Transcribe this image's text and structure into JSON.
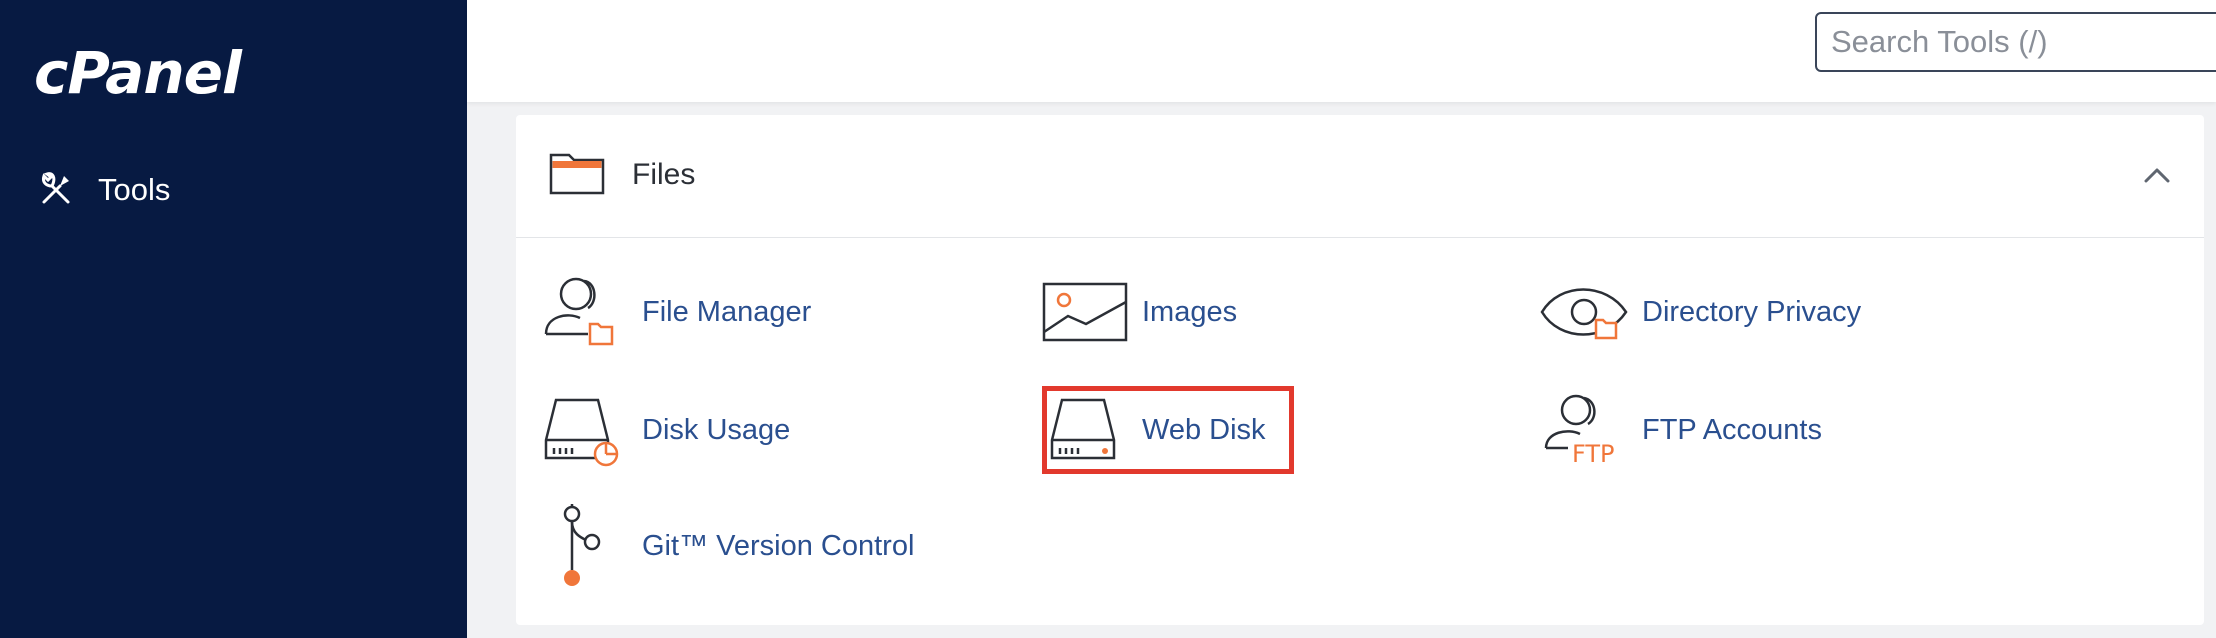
{
  "app": {
    "logo": "cPanel",
    "brand_color": "#071a42",
    "accent_color": "#f0763a",
    "link_color": "#2a4f8f"
  },
  "sidebar": {
    "items": [
      {
        "label": "Tools",
        "icon": "tools-icon"
      }
    ]
  },
  "header": {
    "search_placeholder": "Search Tools (/)",
    "search_value": ""
  },
  "section": {
    "title": "Files",
    "icon": "folder-icon",
    "collapse_icon": "chevron-up-icon",
    "tools": [
      {
        "label": "File Manager",
        "icon": "file-manager-icon"
      },
      {
        "label": "Images",
        "icon": "images-icon"
      },
      {
        "label": "Directory Privacy",
        "icon": "directory-privacy-icon"
      },
      {
        "label": "Disk Usage",
        "icon": "disk-usage-icon"
      },
      {
        "label": "Web Disk",
        "icon": "web-disk-icon",
        "highlighted": true
      },
      {
        "label": "FTP Accounts",
        "icon": "ftp-accounts-icon",
        "icon_text": "FTP"
      },
      {
        "label": "Git™ Version Control",
        "icon": "git-icon"
      }
    ]
  },
  "annotation": {
    "highlight_color": "#e2392d"
  }
}
